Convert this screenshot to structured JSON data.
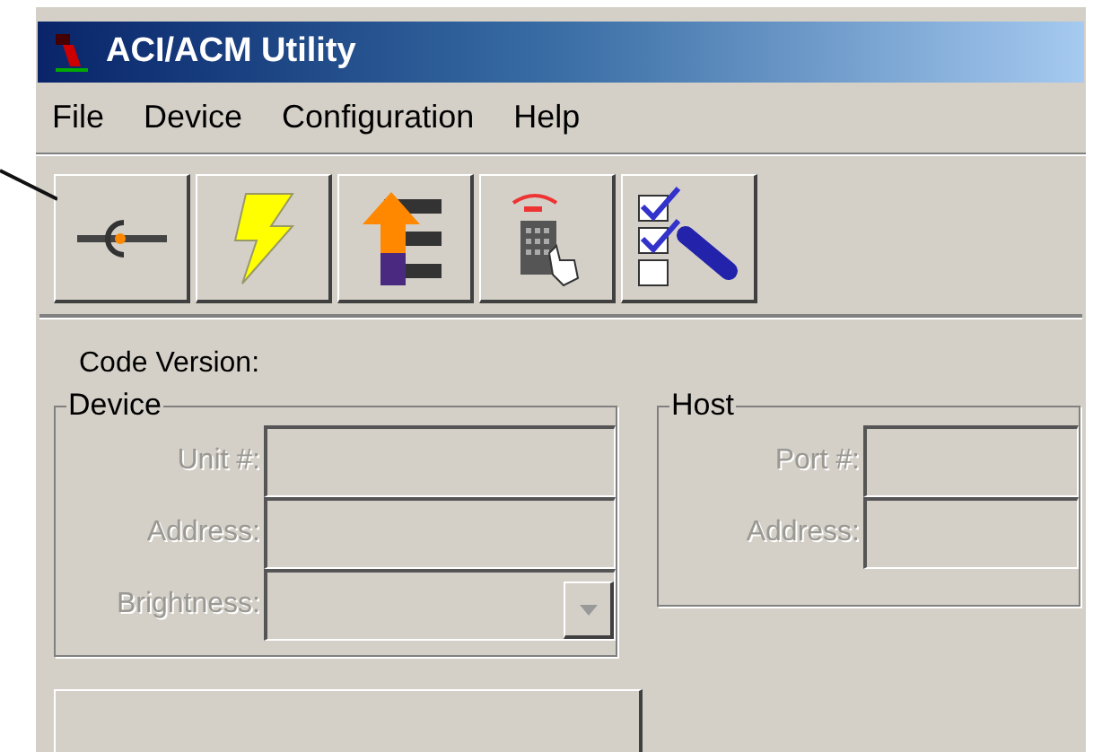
{
  "window": {
    "title": "ACI/ACM Utility"
  },
  "menu": [
    "File",
    "Device",
    "Configuration",
    "Help"
  ],
  "toolbar": [
    {
      "kind": "connect"
    },
    {
      "kind": "bolt"
    },
    {
      "kind": "upload"
    },
    {
      "kind": "keypad"
    },
    {
      "kind": "checklist"
    }
  ],
  "code_version": {
    "label": "Code Version:"
  },
  "groups": [
    {
      "title": "Device",
      "fields": [
        {
          "label": "Unit #:",
          "kind": "text",
          "disabled": true
        },
        {
          "label": "Address:",
          "kind": "text",
          "disabled": true
        },
        {
          "label": "Brightness:",
          "kind": "dropdown",
          "disabled": true
        }
      ]
    },
    {
      "title": "Host",
      "fields": [
        {
          "label": "Port #:",
          "kind": "text",
          "disabled": true
        },
        {
          "label": "Address:",
          "kind": "text",
          "disabled": true
        }
      ]
    }
  ]
}
